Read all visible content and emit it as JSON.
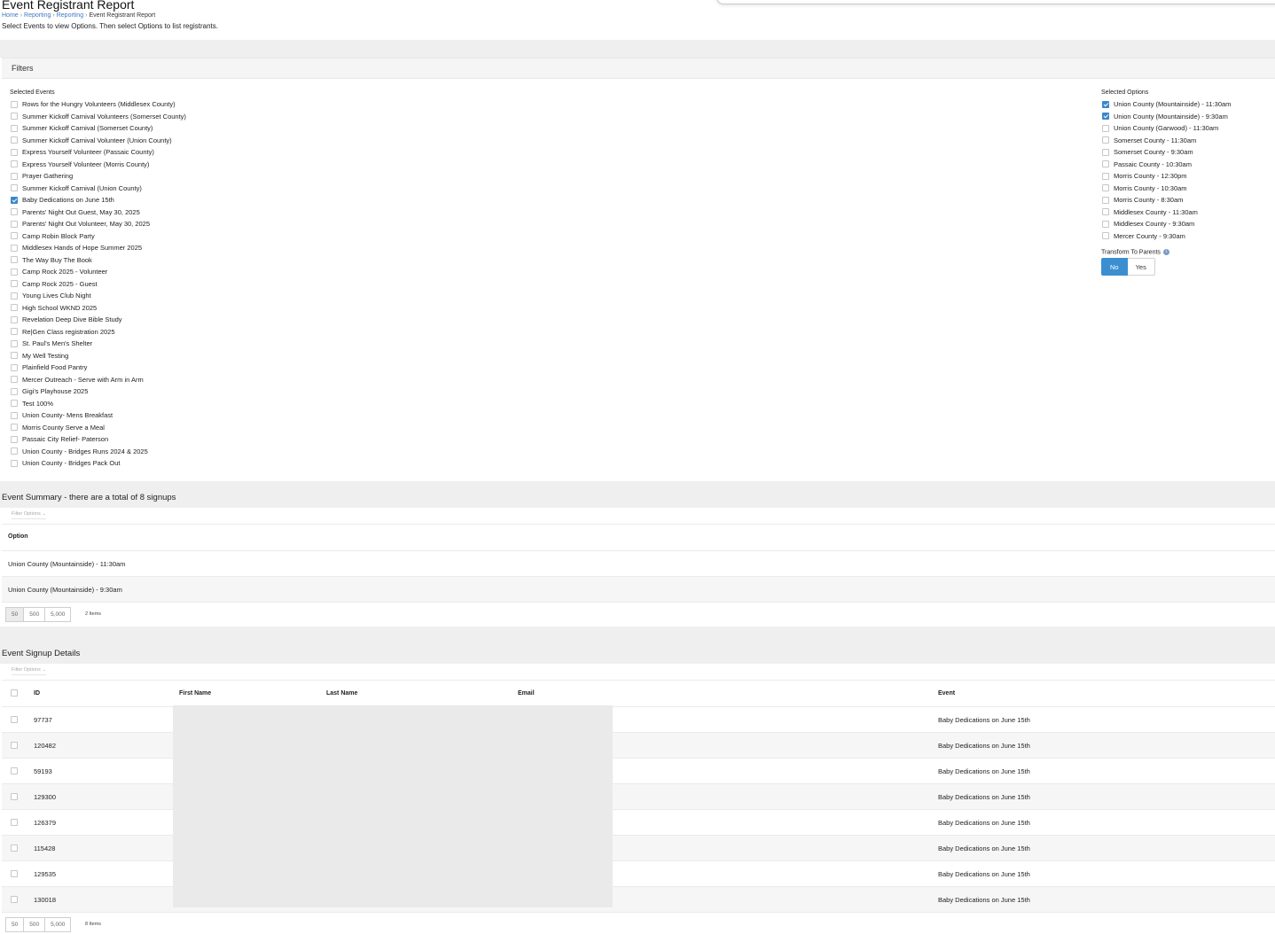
{
  "page": {
    "title": "Event Registrant Report",
    "breadcrumb": [
      "Home",
      "Reporting",
      "Reporting",
      "Event Registrant Report"
    ],
    "breadcrumb_separator": "›",
    "instructions": "Select Events to view Options. Then select Options to list registrants."
  },
  "filters": {
    "title": "Filters",
    "events_label": "Selected Events",
    "events": [
      {
        "label": "Rows for the Hungry Volunteers (Middlesex County)",
        "checked": false
      },
      {
        "label": "Summer Kickoff Carnival Volunteers (Somerset County)",
        "checked": false
      },
      {
        "label": "Summer Kickoff Carnival (Somerset County)",
        "checked": false
      },
      {
        "label": "Summer Kickoff Carnival Volunteer (Union County)",
        "checked": false
      },
      {
        "label": "Express Yourself Volunteer (Passaic County)",
        "checked": false
      },
      {
        "label": "Express Yourself Volunteer (Morris County)",
        "checked": false
      },
      {
        "label": "Prayer Gathering",
        "checked": false
      },
      {
        "label": "Summer Kickoff Carnival (Union County)",
        "checked": false
      },
      {
        "label": "Baby Dedications on June 15th",
        "checked": true
      },
      {
        "label": "Parents' Night Out Guest, May 30, 2025",
        "checked": false
      },
      {
        "label": "Parents' Night Out Volunteer, May 30, 2025",
        "checked": false
      },
      {
        "label": "Camp Robin Block Party",
        "checked": false
      },
      {
        "label": "Middlesex Hands of Hope Summer 2025",
        "checked": false
      },
      {
        "label": "The Way Buy The Book",
        "checked": false
      },
      {
        "label": "Camp Rock 2025 - Volunteer",
        "checked": false
      },
      {
        "label": "Camp Rock 2025 - Guest",
        "checked": false
      },
      {
        "label": "Young Lives Club Night",
        "checked": false
      },
      {
        "label": "High School WKND 2025",
        "checked": false
      },
      {
        "label": "Revelation Deep Dive Bible Study",
        "checked": false
      },
      {
        "label": "Re|Gen Class registration 2025",
        "checked": false
      },
      {
        "label": "St. Paul's Men's Shelter",
        "checked": false
      },
      {
        "label": "My Well Testing",
        "checked": false
      },
      {
        "label": "Plainfield Food Pantry",
        "checked": false
      },
      {
        "label": "Mercer Outreach - Serve with Arm in Arm",
        "checked": false
      },
      {
        "label": "Gigi's Playhouse 2025",
        "checked": false
      },
      {
        "label": "Test 100%",
        "checked": false
      },
      {
        "label": "Union County- Mens Breakfast",
        "checked": false
      },
      {
        "label": "Morris County Serve a Meal",
        "checked": false
      },
      {
        "label": "Passaic City Relief- Paterson",
        "checked": false
      },
      {
        "label": "Union County - Bridges Runs 2024 & 2025",
        "checked": false
      },
      {
        "label": "Union County - Bridges Pack Out",
        "checked": false
      }
    ],
    "options_label": "Selected Options",
    "options": [
      {
        "label": "Union County (Mountainside) - 11:30am",
        "checked": true
      },
      {
        "label": "Union County (Mountainside) - 9:30am",
        "checked": true
      },
      {
        "label": "Union County (Garwood) - 11:30am",
        "checked": false
      },
      {
        "label": "Somerset County - 11:30am",
        "checked": false
      },
      {
        "label": "Somerset County - 9:30am",
        "checked": false
      },
      {
        "label": "Passaic County - 10:30am",
        "checked": false
      },
      {
        "label": "Morris County - 12:30pm",
        "checked": false
      },
      {
        "label": "Morris County - 10:30am",
        "checked": false
      },
      {
        "label": "Morris County - 8:30am",
        "checked": false
      },
      {
        "label": "Middlesex County - 11:30am",
        "checked": false
      },
      {
        "label": "Middlesex County - 9:30am",
        "checked": false
      },
      {
        "label": "Mercer County - 9:30am",
        "checked": false
      }
    ],
    "transform_label": "Transform To Parents",
    "transform_info": "i",
    "transform_options": [
      "No",
      "Yes"
    ],
    "transform_selected": "No"
  },
  "summary": {
    "title": "Event Summary - there are a total of 8 signups",
    "filter_options_label": "Filter Options",
    "column_header": "Option",
    "rows": [
      "Union County (Mountainside) - 11:30am",
      "Union County (Mountainside) - 9:30am"
    ],
    "page_sizes": [
      "50",
      "500",
      "5,000"
    ],
    "items_text": "2 Items"
  },
  "details": {
    "title": "Event Signup Details",
    "filter_options_label": "Filter Options",
    "columns": {
      "id": "ID",
      "first_name": "First Name",
      "last_name": "Last Name",
      "email": "Email",
      "event": "Event"
    },
    "rows": [
      {
        "id": "97737",
        "event": "Baby Dedications on June 15th"
      },
      {
        "id": "120482",
        "event": "Baby Dedications on June 15th"
      },
      {
        "id": "59193",
        "event": "Baby Dedications on June 15th"
      },
      {
        "id": "129300",
        "event": "Baby Dedications on June 15th"
      },
      {
        "id": "126379",
        "event": "Baby Dedications on June 15th"
      },
      {
        "id": "115428",
        "event": "Baby Dedications on June 15th"
      },
      {
        "id": "129535",
        "event": "Baby Dedications on June 15th"
      },
      {
        "id": "130018",
        "event": "Baby Dedications on June 15th"
      }
    ],
    "page_sizes": [
      "50",
      "500",
      "5,000"
    ],
    "items_text": "8 Items"
  },
  "colors": {
    "accent": "#3b87c9",
    "link": "#3a78c3",
    "band": "#efefef"
  }
}
